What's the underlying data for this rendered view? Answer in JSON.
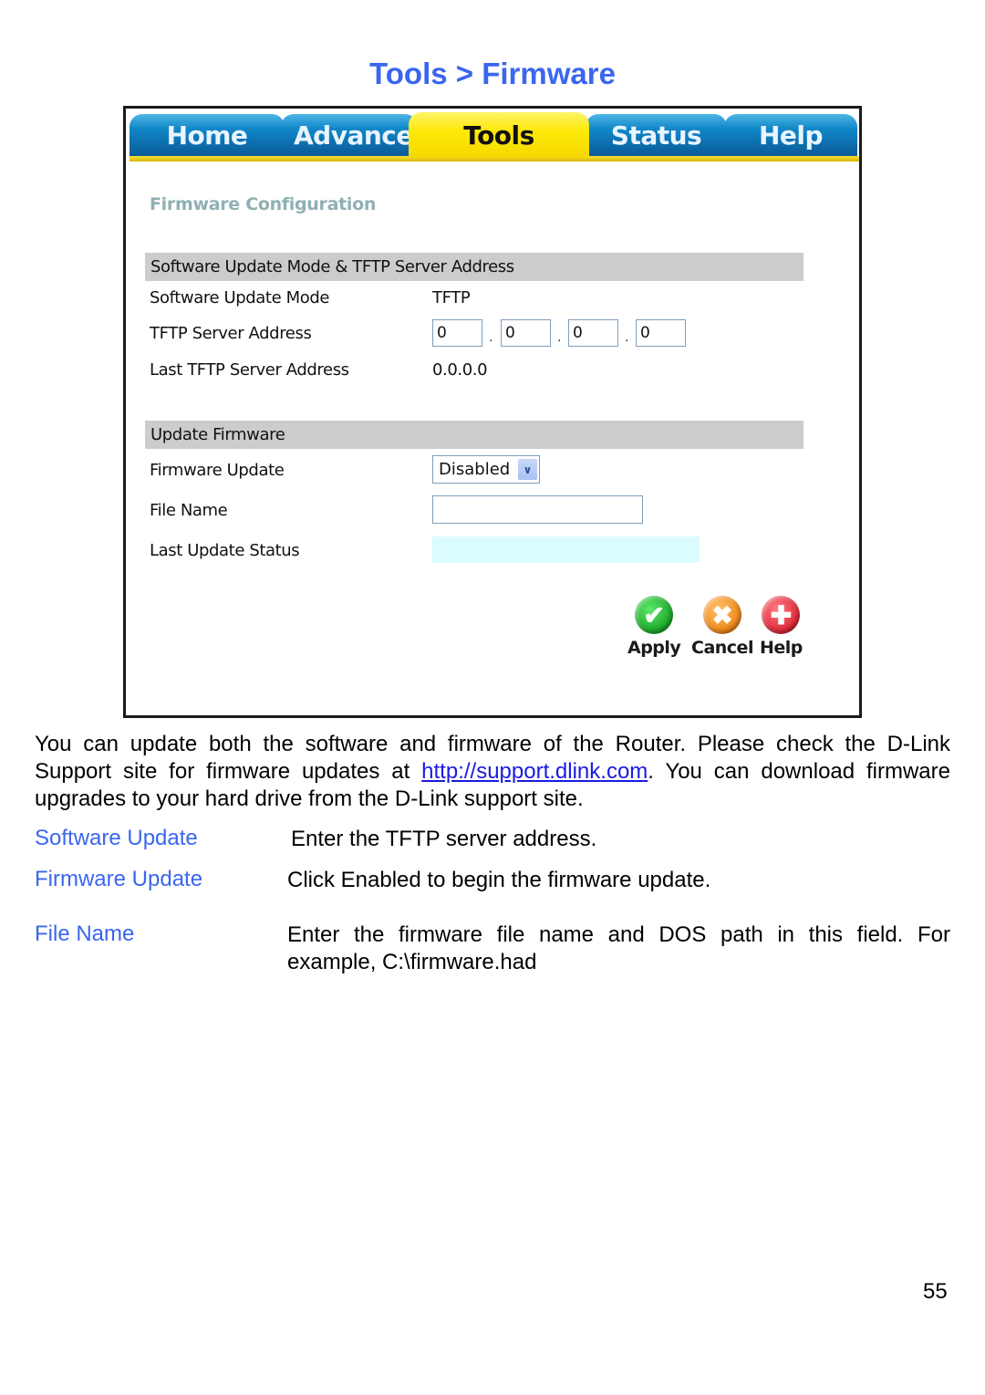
{
  "page_title": "Tools > Firmware",
  "nav": {
    "tabs": [
      {
        "label": "Home",
        "active": false
      },
      {
        "label": "Advanced",
        "active": false
      },
      {
        "label": "Tools",
        "active": true
      },
      {
        "label": "Status",
        "active": false
      },
      {
        "label": "Help",
        "active": false
      }
    ]
  },
  "panel": {
    "title": "Firmware Configuration",
    "section1": {
      "header": "Software Update Mode & TFTP Server Address",
      "rows": {
        "mode_label": "Software Update Mode",
        "mode_value": "TFTP",
        "server_label": "TFTP Server Address",
        "server_octets": [
          "0",
          "0",
          "0",
          "0"
        ],
        "last_server_label": "Last TFTP Server Address",
        "last_server_value": "0.0.0.0"
      }
    },
    "section2": {
      "header": "Update Firmware",
      "rows": {
        "firmware_update_label": "Firmware Update",
        "firmware_update_value": "Disabled",
        "file_name_label": "File Name",
        "file_name_value": "",
        "last_status_label": "Last Update Status",
        "last_status_value": ""
      }
    },
    "actions": {
      "apply": "Apply",
      "cancel": "Cancel",
      "help": "Help"
    }
  },
  "doc": {
    "intro_before_link": "You can update both the software and firmware of the Router.  Please check the D-Link Support site for firmware updates at ",
    "link_text": "http://support.dlink.com",
    "intro_after_link": ". You can download firmware upgrades to your hard drive from the D-Link support site.",
    "definitions": [
      {
        "term": "Software Update",
        "description": "Enter the TFTP server address."
      },
      {
        "term": "Firmware Update",
        "description": "Click Enabled to begin the firmware update."
      },
      {
        "term": "File Name",
        "description": "Enter the firmware file name and DOS path in this field.  For example, C:\\firmware.had"
      }
    ],
    "page_number": "55"
  }
}
